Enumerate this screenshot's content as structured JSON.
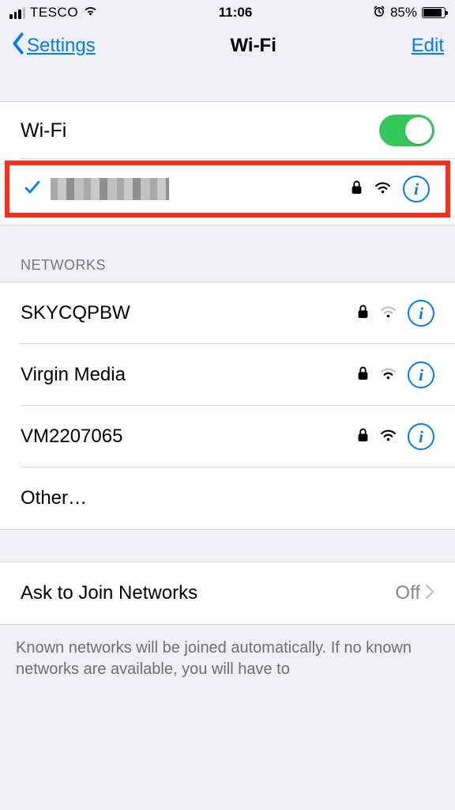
{
  "status": {
    "carrier": "TESCO",
    "time": "11:06",
    "battery_pct": "85%",
    "battery_level": 85
  },
  "nav": {
    "back_label": "Settings",
    "title": "Wi-Fi",
    "edit_label": "Edit"
  },
  "wifi": {
    "toggle_label": "Wi-Fi",
    "enabled": true
  },
  "connected_network": {
    "name_redacted": true,
    "secured": true,
    "signal": "strong"
  },
  "networks_header": "NETWORKS",
  "networks": [
    {
      "name": "SKYCQPBW",
      "secured": true,
      "signal": "weak"
    },
    {
      "name": "Virgin Media",
      "secured": true,
      "signal": "medium"
    },
    {
      "name": "VM2207065",
      "secured": true,
      "signal": "strong"
    }
  ],
  "other_label": "Other…",
  "ask": {
    "label": "Ask to Join Networks",
    "value": "Off"
  },
  "footer": "Known networks will be joined automatically. If no known networks are available, you will have to"
}
